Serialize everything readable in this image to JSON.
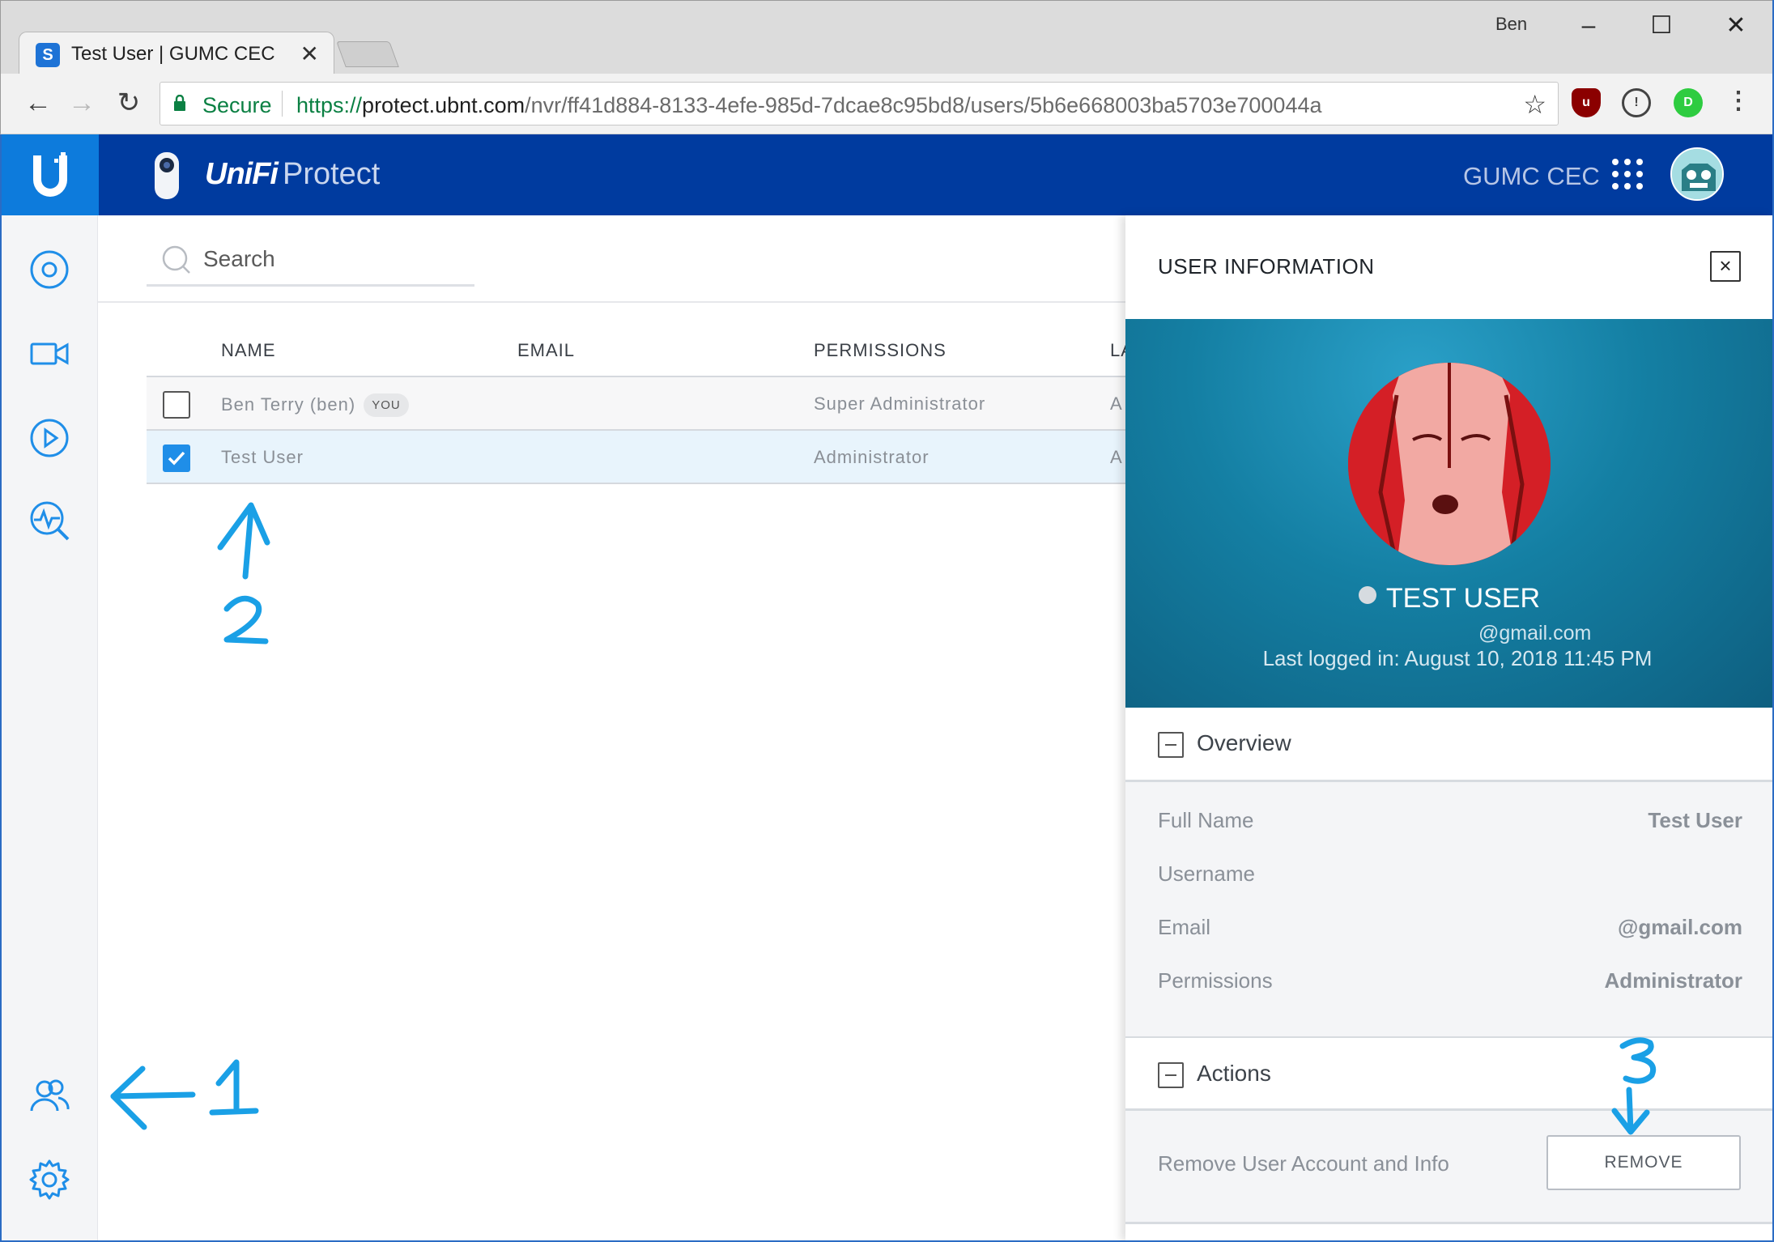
{
  "browser": {
    "tab_title": "Test User | GUMC CEC",
    "profile_name": "Ben",
    "secure_label": "Secure",
    "url_scheme": "https://",
    "url_host": "protect.ubnt.com",
    "url_path": "/nvr/ff41d884-8133-4efe-985d-7dcae8c95bd8/users/5b6e668003ba5703e700044a",
    "icons": [
      "back-icon",
      "forward-icon",
      "reload-icon",
      "lock-icon",
      "star-icon",
      "ublock-icon",
      "onepassword-icon",
      "extension-icon",
      "menu-icon"
    ]
  },
  "app": {
    "brand_unifi": "UniFi",
    "brand_protect": "Protect",
    "site_name": "GUMC CEC",
    "brand_color": "#003b9f",
    "accent_color": "#0d7bdc"
  },
  "sidebar": {
    "items": [
      {
        "icon": "dashboard-icon"
      },
      {
        "icon": "camera-icon"
      },
      {
        "icon": "playback-icon"
      },
      {
        "icon": "detections-icon"
      },
      {
        "icon": "users-icon"
      },
      {
        "icon": "settings-icon"
      }
    ]
  },
  "search": {
    "placeholder": "Search"
  },
  "users_table": {
    "columns": [
      "NAME",
      "EMAIL",
      "PERMISSIONS",
      "LA"
    ],
    "rows": [
      {
        "name": "Ben Terry (ben)",
        "badge": "YOU",
        "email": "",
        "permissions": "Super Administrator",
        "last": "A",
        "checked": false
      },
      {
        "name": "Test User",
        "badge": "",
        "email": "",
        "permissions": "Administrator",
        "last": "A",
        "checked": true
      }
    ]
  },
  "panel": {
    "title": "USER INFORMATION",
    "close_label": "×",
    "profile": {
      "name": "TEST USER",
      "email": "@gmail.com",
      "last_login": "Last logged in: August 10, 2018 11:45 PM"
    },
    "overview": {
      "heading": "Overview",
      "fields": [
        {
          "label": "Full Name",
          "value": "Test User"
        },
        {
          "label": "Username",
          "value": ""
        },
        {
          "label": "Email",
          "value": "@gmail.com"
        },
        {
          "label": "Permissions",
          "value": "Administrator"
        }
      ]
    },
    "actions": {
      "heading": "Actions",
      "remove_label": "Remove User Account and Info",
      "remove_button": "REMOVE"
    }
  },
  "annotations": {
    "color": "#1aa0e6",
    "labels": [
      "1",
      "2",
      "3"
    ]
  }
}
